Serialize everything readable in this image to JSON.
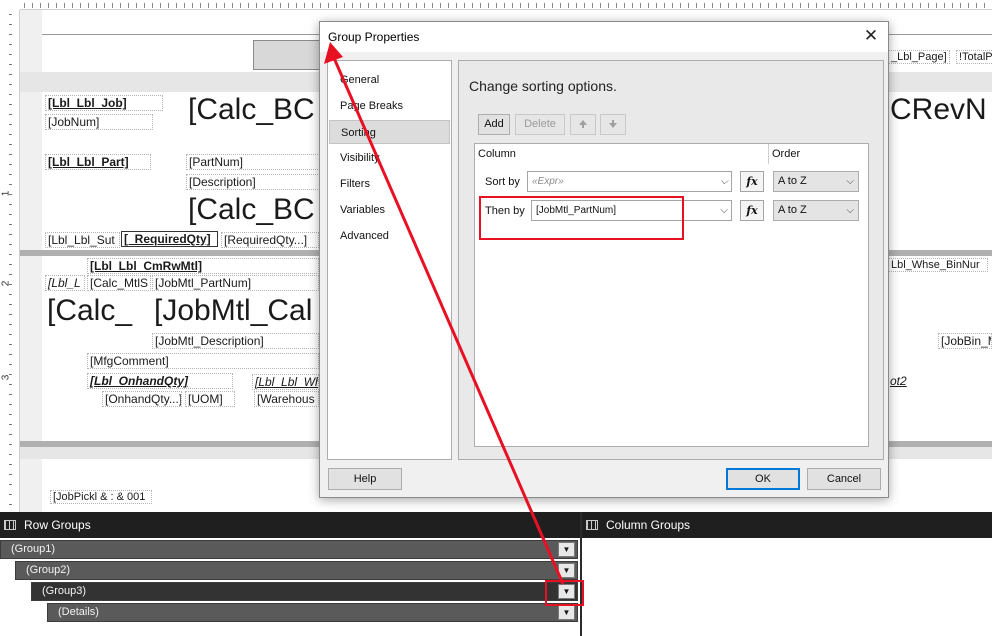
{
  "dialog": {
    "title": "Group Properties",
    "close_glyph": "✕",
    "nav_items": [
      "General",
      "Page Breaks",
      "Sorting",
      "Visibility",
      "Filters",
      "Variables",
      "Advanced"
    ],
    "selected_nav": "Sorting",
    "heading": "Change sorting options.",
    "toolbar": {
      "add": "Add",
      "delete": "Delete",
      "move_up_icon": "arrow-up-icon",
      "move_down_icon": "arrow-down-icon"
    },
    "grid": {
      "column_header": "Column",
      "order_header": "Order",
      "rows": [
        {
          "label": "Sort by",
          "expression": "«Expr»",
          "order": "A to Z"
        },
        {
          "label": "Then by",
          "expression": "[JobMtl_PartNum]",
          "order": "A to Z"
        }
      ],
      "fx_label": "fx"
    },
    "buttons": {
      "help": "Help",
      "ok": "OK",
      "cancel": "Cancel"
    }
  },
  "row_groups": {
    "title": "Row Groups",
    "groups": [
      "(Group1)",
      "(Group2)",
      "(Group3)",
      "(Details)"
    ]
  },
  "column_groups": {
    "title": "Column Groups"
  },
  "report_fields": {
    "lbl_job": "[Lbl_Lbl_Job]",
    "job_num": "[JobNum]",
    "calc_bc_1": "[Calc_BC",
    "crevn": "CRevN",
    "lbl_part": "[Lbl_Lbl_Part]",
    "part_num": "[PartNum]",
    "description": "[Description]",
    "calc_bc_2": "[Calc_BC",
    "lbl_sub": "[Lbl_Lbl_Sut",
    "required_qty_lbl": "[_RequiredQty]",
    "required_qty": "[RequiredQty...]",
    "lbl_cmrwmtl": "[Lbl_Lbl_CmRwMtl]",
    "lbl_l": "[Lbl_L",
    "calc_mtls": "[Calc_MtlS",
    "jobmtl_partnum": "[JobMtl_PartNum]",
    "calc_big": "[Calc_",
    "jobmtl_cal": "[JobMtl_Cal",
    "jobmtl_desc": "[JobMtl_Description]",
    "mfg_comment": "[MfgComment]",
    "lbl_onhand": "[Lbl_OnhandQty]",
    "lbl_wh": "[Lbl_Lbl_Wh",
    "onhand_qty": "[OnhandQty...]",
    "uom": "[UOM]",
    "warehouse": "[Warehous",
    "lbl_page": "_Lbl_Page]",
    "total_p": "!TotalP",
    "lbl_whse_bin": "Lbl_Whse_BinNur",
    "jobbin": "[JobBin_M",
    "ot2": "ot2",
    "jobpickl": "[JobPickl & : & 001"
  },
  "ruler": {
    "v_labels": [
      "1",
      "2",
      "3"
    ]
  },
  "colors": {
    "annotation_red": "#e81123",
    "pane_dark": "#1f1f1f",
    "group_bar": "#5a5a5a",
    "ok_border": "#0078d7"
  }
}
